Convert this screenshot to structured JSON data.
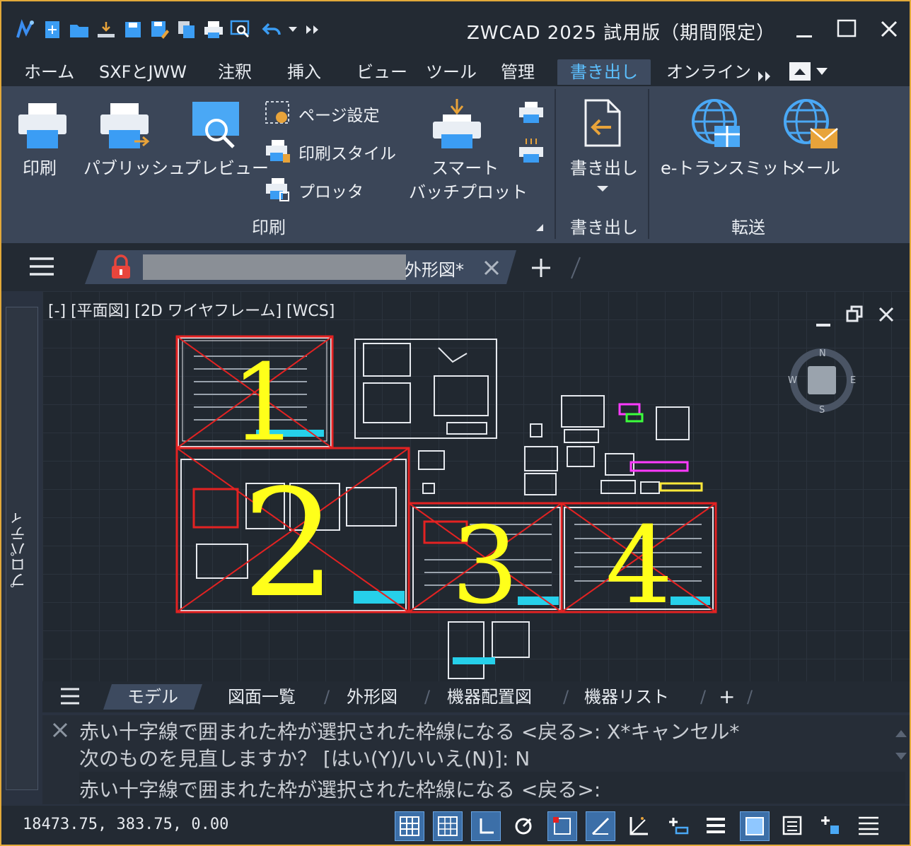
{
  "app": {
    "title": "ZWCAD 2025 試用版（期間限定）"
  },
  "quick_access": [
    "logo-icon",
    "new-icon",
    "open-icon",
    "upload-icon",
    "save-icon",
    "save-as-icon",
    "copy-icon",
    "print-icon",
    "preview-icon",
    "undo-icon",
    "dropdown-icon",
    "more-icon"
  ],
  "menu": {
    "items": [
      "ホーム",
      "SXFとJWW",
      "注釈",
      "挿入",
      "ビュー",
      "ツール",
      "管理",
      "書き出し",
      "オンライン"
    ],
    "active": "書き出し"
  },
  "ribbon": {
    "print_group": {
      "label": "印刷",
      "print": "印刷",
      "publish": "パブリッシュ",
      "preview": "プレビュー",
      "page_setup": "ページ設定",
      "print_style": "印刷スタイル",
      "plotter": "プロッタ",
      "smart_batch_line1": "スマート",
      "smart_batch_line2": "バッチプロット"
    },
    "export_group": {
      "label": "書き出し",
      "export": "書き出し"
    },
    "transfer_group": {
      "label": "転送",
      "etransmit": "e-トランスミット",
      "mail": "メール"
    }
  },
  "document": {
    "tab_name": "外形図*"
  },
  "viewport": {
    "label": "[-] [平面図] [2D ワイヤフレーム] [WCS]",
    "compass": {
      "n": "N",
      "s": "S",
      "w": "W",
      "e": "E"
    },
    "sheets": [
      "1",
      "2",
      "3",
      "4"
    ]
  },
  "side_panel": {
    "label": "プロパティ"
  },
  "layout_tabs": {
    "items": [
      "モデル",
      "図面一覧",
      "外形図",
      "機器配置図",
      "機器リスト"
    ],
    "add": "+"
  },
  "command": {
    "history": [
      "赤い十字線で囲まれた枠が選択された枠線になる <戻る>: X*キャンセル*",
      "次のものを見直しますか？ [はい(Y)/いいえ(N)]: N"
    ],
    "prompt": "赤い十字線で囲まれた枠が選択された枠線になる <戻る>:"
  },
  "status": {
    "coordinates": "18473.75, 383.75, 0.00"
  }
}
